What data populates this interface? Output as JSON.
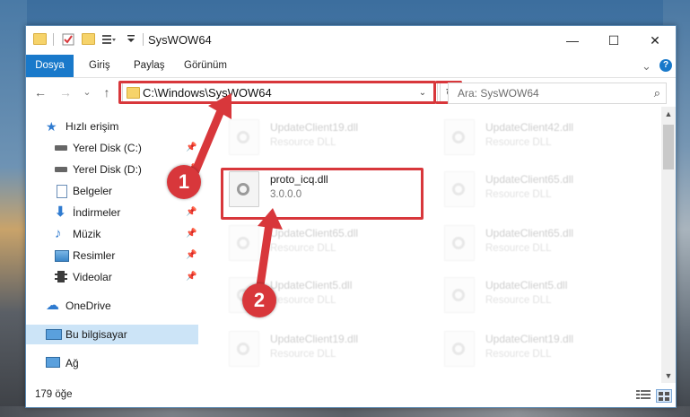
{
  "window": {
    "title": "SysWOW64",
    "minimize_glyph": "—",
    "maximize_glyph": "☐",
    "close_glyph": "✕"
  },
  "ribbon": {
    "tabs": [
      "Dosya",
      "Giriş",
      "Paylaş",
      "Görünüm"
    ],
    "expand_glyph": "⌄",
    "help_glyph": "?"
  },
  "address_bar": {
    "path": "C:\\Windows\\SysWOW64",
    "back_glyph": "←",
    "forward_glyph": "→",
    "recent_glyph": "⌄",
    "up_glyph": "↑",
    "dropdown_glyph": "⌄",
    "refresh_glyph": "↻"
  },
  "search": {
    "placeholder": "Ara: SysWOW64",
    "icon_glyph": "⌕"
  },
  "nav_pane": {
    "items": [
      {
        "label": "Hızlı erişim",
        "icon": "star-icon",
        "pinned": false
      },
      {
        "label": "Yerel Disk (C:)",
        "icon": "drive-icon",
        "pinned": true
      },
      {
        "label": "Yerel Disk (D:)",
        "icon": "drive-icon",
        "pinned": true
      },
      {
        "label": "Belgeler",
        "icon": "documents-icon",
        "pinned": true
      },
      {
        "label": "İndirmeler",
        "icon": "download-icon",
        "pinned": true
      },
      {
        "label": "Müzik",
        "icon": "music-icon",
        "pinned": true
      },
      {
        "label": "Resimler",
        "icon": "pictures-icon",
        "pinned": true
      },
      {
        "label": "Videolar",
        "icon": "videos-icon",
        "pinned": true
      },
      {
        "label": "OneDrive",
        "icon": "cloud-icon",
        "pinned": false
      },
      {
        "label": "Bu bilgisayar",
        "icon": "computer-icon",
        "pinned": false
      },
      {
        "label": "Ağ",
        "icon": "network-icon",
        "pinned": false
      }
    ],
    "pin_glyph": "📌"
  },
  "files": [
    {
      "name": "UpdateClient19.dll",
      "type": "Resource DLL",
      "faded": true
    },
    {
      "name": "UpdateClient42.dll",
      "type": "Resource DLL",
      "faded": true
    },
    {
      "name": "proto_icq.dll",
      "type": "3.0.0.0",
      "faded": false
    },
    {
      "name": "UpdateClient65.dll",
      "type": "Resource DLL",
      "faded": true
    },
    {
      "name": "UpdateClient65.dll",
      "type": "Resource DLL",
      "faded": true
    },
    {
      "name": "UpdateClient65.dll",
      "type": "Resource DLL",
      "faded": true
    },
    {
      "name": "UpdateClient5.dll",
      "type": "Resource DLL",
      "faded": true
    },
    {
      "name": "UpdateClient5.dll",
      "type": "Resource DLL",
      "faded": true
    },
    {
      "name": "UpdateClient19.dll",
      "type": "Resource DLL",
      "faded": true
    },
    {
      "name": "UpdateClient19.dll",
      "type": "Resource DLL",
      "faded": true
    }
  ],
  "status": {
    "item_count": "179 öğe"
  },
  "annotations": {
    "step1": "1",
    "step2": "2",
    "accent": "#d8373b"
  },
  "colors": {
    "file_tab": "#1979ca",
    "selected_nav": "#cce4f7"
  }
}
